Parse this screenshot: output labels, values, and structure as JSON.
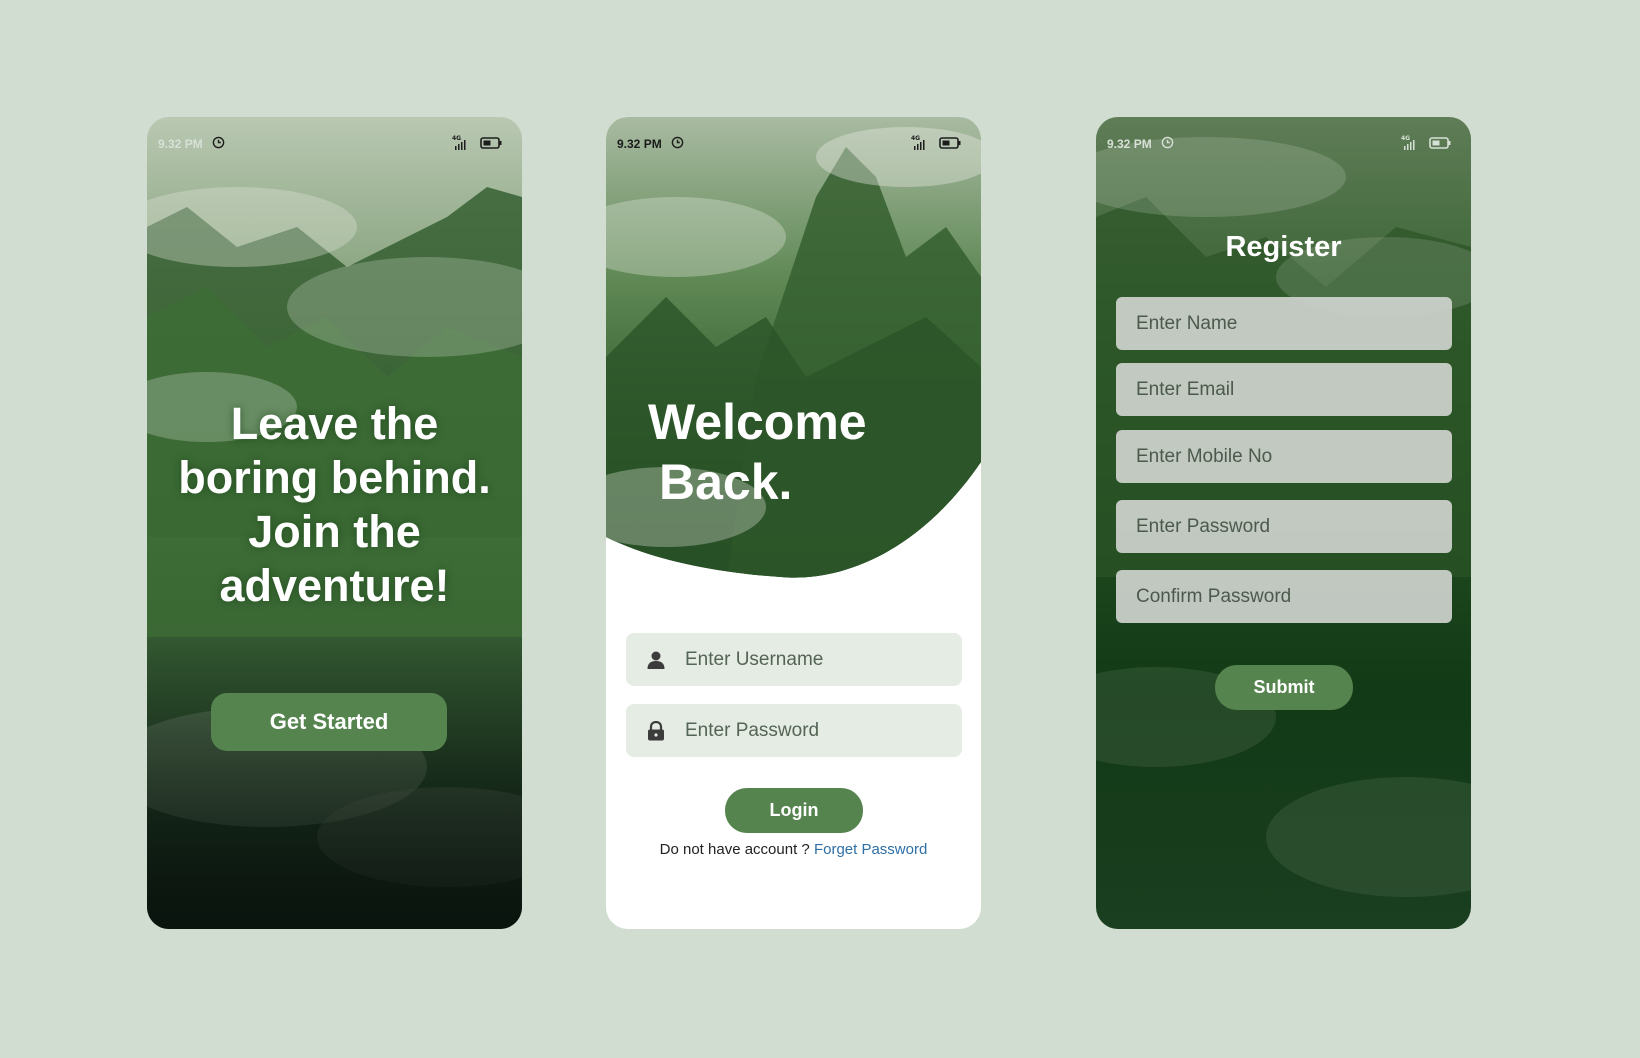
{
  "status_bar": {
    "time": "9.32 PM",
    "network": "4G"
  },
  "splash": {
    "headline_lines": [
      "Leave the",
      "boring behind.",
      "Join the",
      "adventure!"
    ],
    "cta_label": "Get Started"
  },
  "login": {
    "headline_line1": "Welcome",
    "headline_line2": "Back.",
    "username_placeholder": "Enter Username",
    "password_placeholder": "Enter Password",
    "login_label": "Login",
    "no_account_text": "Do not have account ?",
    "forget_password_label": "Forget Password"
  },
  "register": {
    "title": "Register",
    "name_placeholder": "Enter Name",
    "email_placeholder": "Enter Email",
    "mobile_placeholder": "Enter Mobile No",
    "password_placeholder": "Enter Password",
    "confirm_placeholder": "Confirm Password",
    "submit_label": "Submit"
  },
  "colors": {
    "page_background": "#d2ddd1",
    "accent_green": "#56844f",
    "link_blue": "#2e6fa6"
  }
}
